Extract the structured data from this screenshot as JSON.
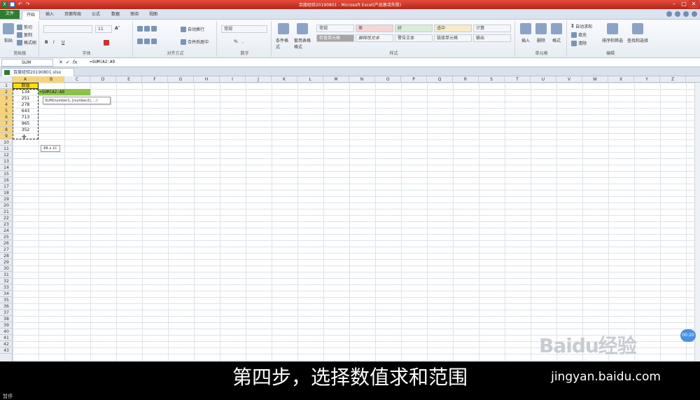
{
  "window": {
    "title": "百度经验20190801 - Microsoft Excel(产品激活失败)",
    "buttons": {
      "minimize": "–",
      "maximize": "□",
      "close": "✕"
    }
  },
  "ribbon_tabs": [
    "文件",
    "开始",
    "插入",
    "页面布局",
    "公式",
    "数据",
    "审阅",
    "视图"
  ],
  "ribbon": {
    "clipboard": {
      "paste": "粘贴",
      "cut": "剪切",
      "copy": "复制",
      "painter": "格式刷",
      "label": "剪贴板"
    },
    "font": {
      "size": "11",
      "label": "字体"
    },
    "alignment": {
      "wrap": "自动换行",
      "merge": "合并后居中",
      "label": "对齐方式"
    },
    "number": {
      "format": "常规",
      "label": "数字"
    },
    "styles": {
      "conditional": "条件格式",
      "table": "套用表格格式",
      "cells": [
        "常规",
        "差",
        "好",
        "适中",
        "计算",
        "检查单元格",
        "解释性文本",
        "警告文本",
        "链接单元格",
        "输出"
      ],
      "label": "样式"
    },
    "cells": {
      "insert": "插入",
      "delete": "删除",
      "format": "格式",
      "label": "单元格"
    },
    "editing": {
      "autosum": "自动求和",
      "fill": "填充",
      "clear": "清除",
      "sort": "排序和筛选",
      "find": "查找和选择",
      "label": "编辑"
    }
  },
  "formula_bar": {
    "name_box": "SUM",
    "icons": [
      "✕",
      "✓",
      "fx"
    ],
    "formula": "=SUM(A2:A9"
  },
  "workbook_tab": "百度经验20190801.xlsx",
  "columns": [
    "A",
    "B",
    "C",
    "D",
    "E",
    "F",
    "G",
    "H",
    "I",
    "J",
    "K",
    "L",
    "M",
    "N",
    "O",
    "P",
    "Q",
    "R",
    "S",
    "T",
    "U",
    "V",
    "W",
    "X",
    "Y",
    "Z"
  ],
  "rows": [
    "1",
    "2",
    "3",
    "4",
    "5",
    "6",
    "7",
    "8",
    "9",
    "10",
    "11",
    "12",
    "13",
    "14",
    "15",
    "16",
    "17",
    "18",
    "19",
    "20",
    "21",
    "22",
    "23",
    "24",
    "25",
    "26",
    "27",
    "28",
    "29",
    "30",
    "31",
    "32",
    "33",
    "34",
    "35",
    "36",
    "37",
    "38",
    "39",
    "40",
    "41",
    "42",
    "43"
  ],
  "cells": {
    "A1": "数值",
    "A_values": [
      "134",
      "251",
      "278",
      "643",
      "713",
      "965",
      "352"
    ],
    "B2": "=SUM(A2:A9"
  },
  "tooltip": "SUM(number1, [number2], ...)",
  "size_hint": "8R x 1C",
  "timer": "00:20",
  "watermark": "Baidu经验",
  "caption": "第四步，选择数值求和范围",
  "site": "jingyan.baidu.com",
  "status": "暂停"
}
